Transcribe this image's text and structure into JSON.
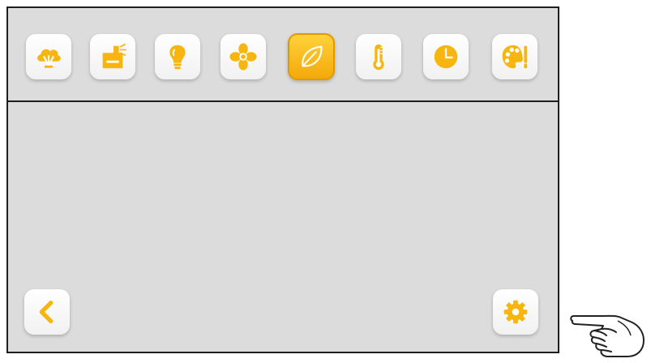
{
  "colors": {
    "screen_bg": "#dcdcdc",
    "accent_yellow": "#f7b50f",
    "active_fill": "#f4a90a",
    "border": "#1e1e1e"
  },
  "toolbar": {
    "icons": [
      {
        "name": "steam-cloud-icon",
        "active": false
      },
      {
        "name": "hood-icon",
        "active": false
      },
      {
        "name": "light-bulb-icon",
        "active": false
      },
      {
        "name": "fan-icon",
        "active": false
      },
      {
        "name": "leaf-eco-icon",
        "active": true
      },
      {
        "name": "thermometer-icon",
        "active": false
      },
      {
        "name": "clock-icon",
        "active": false
      },
      {
        "name": "palette-icon",
        "active": false
      }
    ]
  },
  "footer": {
    "back_icon": "chevron-left-icon",
    "settings_icon": "gear-icon"
  },
  "decor": {
    "pointer": "pointing-hand-icon"
  }
}
